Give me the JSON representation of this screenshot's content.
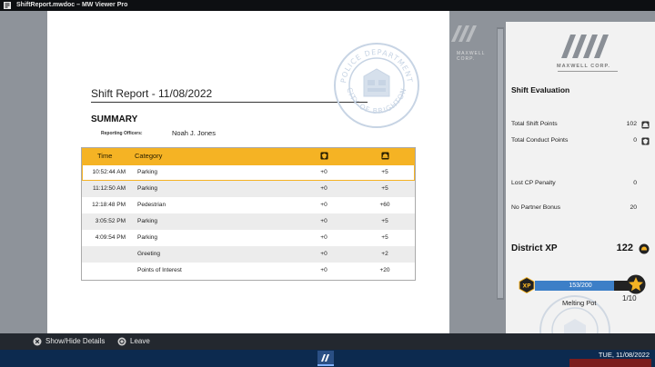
{
  "titlebar": {
    "title": "ShiftReport.mwdoc – MW Viewer Pro"
  },
  "document": {
    "title": "Shift Report - 11/08/2022",
    "summary_heading": "SUMMARY",
    "officers_label": "Reporting Officers:",
    "officers_value": "Noah J. Jones",
    "seal_text": [
      "POLICE DEPARTMENT",
      "CITY OF BRIGHTON"
    ],
    "table": {
      "headers": {
        "time": "Time",
        "category": "Category",
        "cp_icon": "badge-icon",
        "xp_icon": "helmet-icon"
      },
      "rows": [
        {
          "time": "10:52:44 AM",
          "category": "Parking",
          "cp": "+0",
          "xp": "+5"
        },
        {
          "time": "11:12:50 AM",
          "category": "Parking",
          "cp": "+0",
          "xp": "+5"
        },
        {
          "time": "12:18:48 PM",
          "category": "Pedestrian",
          "cp": "+0",
          "xp": "+60"
        },
        {
          "time": "3:05:52 PM",
          "category": "Parking",
          "cp": "+0",
          "xp": "+5"
        },
        {
          "time": "4:09:54 PM",
          "category": "Parking",
          "cp": "+0",
          "xp": "+5"
        },
        {
          "time": "",
          "category": "Greeting",
          "cp": "+0",
          "xp": "+2"
        },
        {
          "time": "",
          "category": "Points of Interest",
          "cp": "+0",
          "xp": "+20"
        }
      ]
    }
  },
  "panel": {
    "logo_text": "MAXWELL CORP.",
    "title": "Shift Evaluation",
    "stats": [
      {
        "label": "Total Shift Points",
        "value": "102",
        "icon": "helmet-icon"
      },
      {
        "label": "Total Conduct Points",
        "value": "0",
        "icon": "badge-icon"
      },
      {
        "label": "Lost CP Penalty",
        "value": "0",
        "icon": ""
      },
      {
        "label": "No Partner Bonus",
        "value": "20",
        "icon": ""
      }
    ],
    "district_label": "District XP",
    "district_value": "122",
    "xp_badge": "XP",
    "xp_bar_text": "153/200",
    "xp_progress": 0.765,
    "level_name": "Melting Pot",
    "level_fraction": "1/10"
  },
  "hints": {
    "details": "Show/Hide Details",
    "leave": "Leave"
  },
  "taskbar": {
    "date": "TUE, 11/08/2022"
  },
  "colors": {
    "accent": "#f5b324",
    "xp_blue": "#3d7fc7",
    "taskbar": "#0c2a4f"
  }
}
